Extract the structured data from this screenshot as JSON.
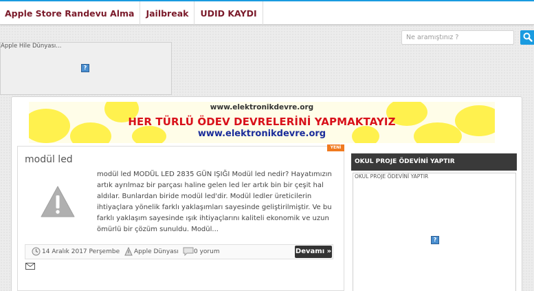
{
  "nav": {
    "items": [
      {
        "label": "Apple Store Randevu Alma"
      },
      {
        "label": "Jailbreak"
      },
      {
        "label": "UDID KAYDI"
      }
    ],
    "accent_color": "#1a9be0"
  },
  "search": {
    "placeholder": "Ne aramıştınız ?",
    "button_icon": "search-icon"
  },
  "top_ad": {
    "label": "Apple Hile Dünyası..."
  },
  "banner": {
    "site": "www.elektronikdevre.org",
    "headline": "HER TÜRLÜ ÖDEV DEVRELERİNİ YAPMAKTAYIZ",
    "url": "www.elektronikdevre.org"
  },
  "post": {
    "badge": "YENİ",
    "title": "modül led",
    "excerpt": "modül led MODÜL LED 2835 GÜN IŞIĞI Modül led nedir? Hayatımızın  artık ayrılmaz bir parçası haline gelen led ler artık bin bir çeşit hal aldılar. Bunlardan biride modül led'dir. Modül ledler üreticilerin ihtiyaçlara yönelik farklı yaklaşımları sayesinde geliştirilmiştir. Ve bu farklı yaklaşım sayesinde ışık ihtiyaçlarını kaliteli ekonomik ve uzun ömürlü bir çözüm sunuldu. Modül...",
    "date": "14 Aralık 2017 Perşembe",
    "author": "Apple Dünyası",
    "comments": "0 yorum",
    "read_more": "Devamı »",
    "thumbnail_icon": "warning-icon"
  },
  "sidebar": {
    "header": "OKUL PROJE ÖDEVİNİ YAPTIR",
    "widget_label": "OKUL PROJE ÖDEVİNİ YAPTIR"
  }
}
